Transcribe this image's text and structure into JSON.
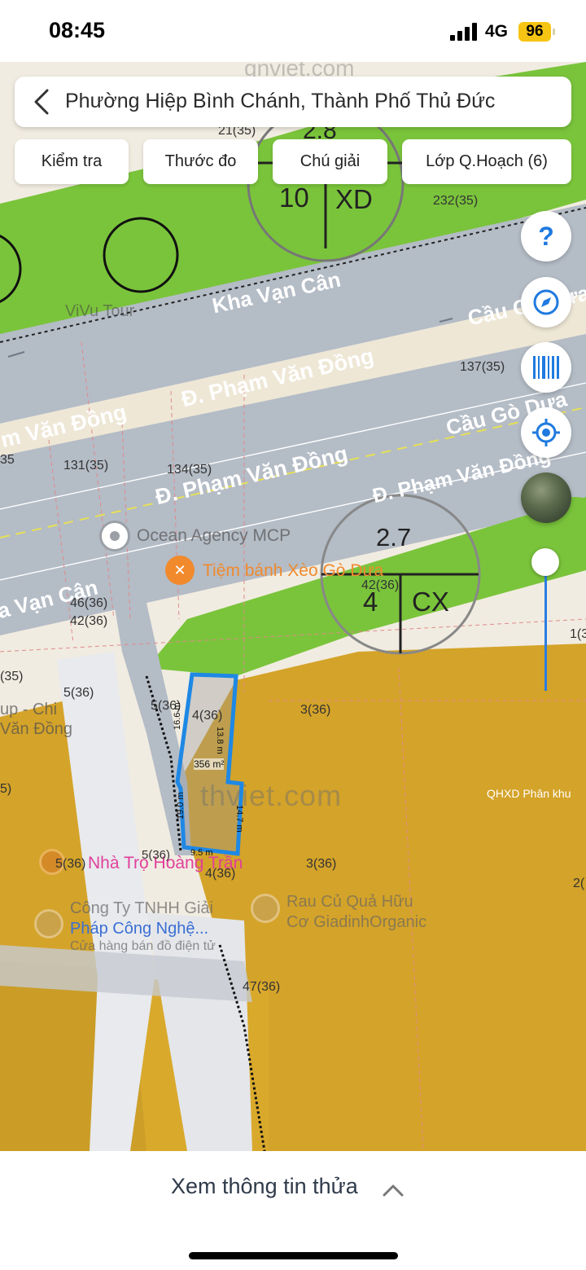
{
  "status_bar": {
    "time": "08:45",
    "network": "4G",
    "battery": "96"
  },
  "header": {
    "title": "Phường Hiệp Bình Chánh, Thành Phố Thủ Đức"
  },
  "toolbar": {
    "chips": [
      {
        "label": "Kiểm tra"
      },
      {
        "label": "Thước đo"
      },
      {
        "label": "Chú giải"
      },
      {
        "label": "Lớp Q.Hoạch (6)"
      }
    ]
  },
  "map": {
    "watermark_top": "gnviet.com",
    "watermark_center": "thviet.com",
    "roads": {
      "kha_van_can_top": "Kha Vạn Cân",
      "pham_van_dong_1": "Đ. Phạm Văn Đồng",
      "pham_van_dong_left": "m Văn Đồng",
      "pham_van_dong_2": "Đ. Phạm Văn Đồng",
      "pham_van_dong_3": "Đ. Phạm Văn Đồng",
      "cau_go_dua_1": "Cầu Gò Dưa",
      "cau_go_dua_2": "Cầu Gò Dưa",
      "kha_van_can_bottom": "a Vạn Cân",
      "pham_van_dong_partial": "Văn Đồng",
      "chi_label": "up - Chi"
    },
    "zones": {
      "xd_density": "2.8",
      "xd_floors": "10",
      "xd_code": "XD",
      "cx_density": "2.7",
      "cx_floors": "4",
      "cx_code": "CX",
      "qhxd_label": "QHXD Phân khu"
    },
    "parcel_numbers": [
      "21(35)",
      "232(35)",
      "137(35)",
      "131(35)",
      "134(35)",
      "35",
      "42(36)",
      "46(36)",
      "42(36)",
      "(35)",
      "5(36)",
      "5(36)",
      "4(36)",
      "3(36)",
      "5)",
      "5(36)",
      "5(36)",
      "4(36)",
      "3(36)",
      "47(36)",
      "1(3",
      "2("
    ],
    "pois": {
      "vivu": "ViVu Tour",
      "ocean": "Ocean Agency MCP",
      "tiem_banh": "Tiệm bánh Xèo Gò Dưa",
      "nha_tro": "Nhà Trọ Hoàng Trần",
      "cong_ty_1": "Công Ty TNHH Giải",
      "cong_ty_2": "Pháp Công Nghệ...",
      "cong_ty_3": "Cửa hàng bán đồ điện tử",
      "rau_cu_1": "Rau Củ Quả Hữu",
      "rau_cu_2": "Cơ GiadinhOrganic"
    },
    "plot": {
      "area": "356 m²",
      "side_left_top": "16.6 m",
      "side_right_top": "13.8 m",
      "side_left_bottom": "19.0 m",
      "side_right_bottom": "14.7 m",
      "side_bottom": "9.5 m"
    }
  },
  "controls": [
    "help-button",
    "compass-button",
    "barcode-button",
    "locate-button",
    "satellite-layer-button"
  ],
  "bottom_sheet": {
    "label": "Xem thông tin thửa"
  },
  "colors": {
    "green": "#7ac43b",
    "ochre": "#d4a329",
    "road": "#b4bcc6",
    "plot_outline": "#1e88e5",
    "accent": "#1f7ae0"
  }
}
